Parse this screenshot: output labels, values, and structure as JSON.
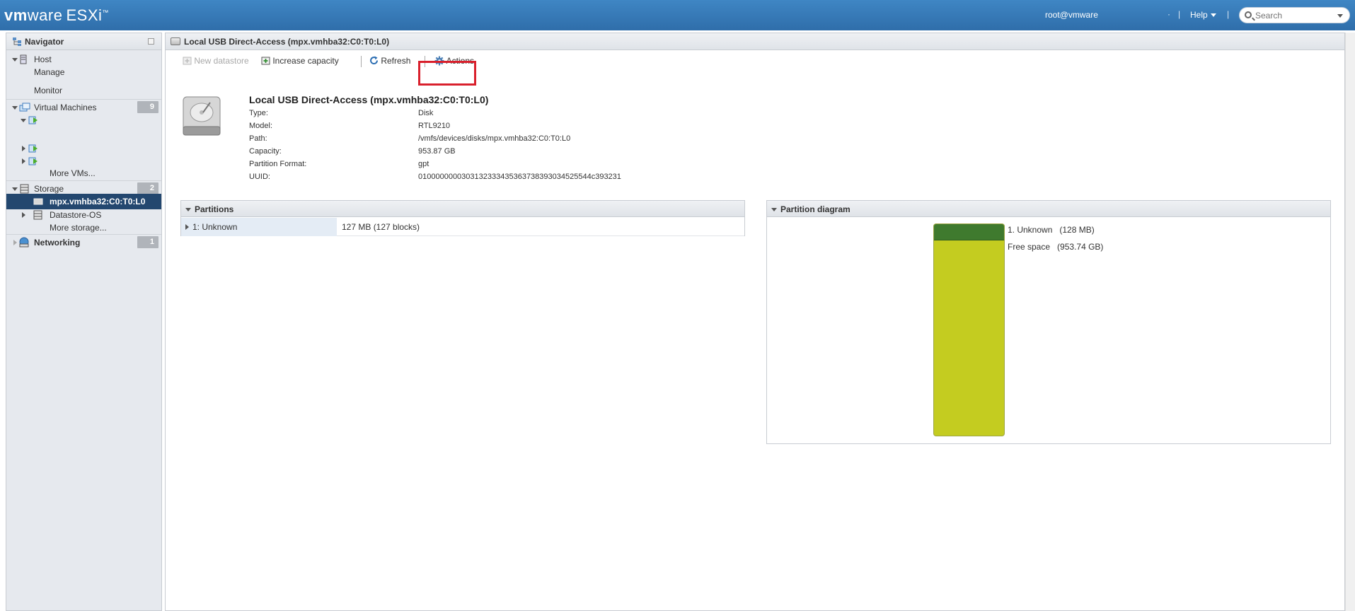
{
  "header": {
    "brand_vm": "vm",
    "brand_ware": "ware",
    "brand_product": "ESXi",
    "user": "root@vmware",
    "sep1": "·",
    "sep2": "|",
    "help_label": "Help",
    "sep3": "|",
    "search_placeholder": "Search"
  },
  "navigator": {
    "title": "Navigator",
    "host": {
      "label": "Host",
      "manage": "Manage",
      "monitor": "Monitor"
    },
    "virtual_machines": {
      "label": "Virtual Machines",
      "count": "9",
      "more": "More VMs..."
    },
    "storage": {
      "label": "Storage",
      "count": "2",
      "selected": "mpx.vmhba32:C0:T0:L0",
      "datastore": "Datastore-OS",
      "more": "More storage..."
    },
    "networking": {
      "label": "Networking",
      "count": "1"
    }
  },
  "main": {
    "title": "Local USB Direct-Access (mpx.vmhba32:C0:T0:L0)",
    "toolbar": {
      "new_datastore": "New datastore",
      "increase_capacity": "Increase capacity",
      "refresh": "Refresh",
      "actions": "Actions"
    },
    "info": {
      "title": "Local USB Direct-Access (mpx.vmhba32:C0:T0:L0)",
      "rows": [
        {
          "key": "Type:",
          "value": "Disk"
        },
        {
          "key": "Model:",
          "value": "RTL9210"
        },
        {
          "key": "Path:",
          "value": "/vmfs/devices/disks/mpx.vmhba32:C0:T0:L0"
        },
        {
          "key": "Capacity:",
          "value": "953.87 GB"
        },
        {
          "key": "Partition Format:",
          "value": "gpt"
        },
        {
          "key": "UUID:",
          "value": "0100000000303132333435363738393034525544c393231"
        }
      ]
    },
    "partitions": {
      "title": "Partitions",
      "rows": [
        {
          "name": "1: Unknown",
          "size": "127 MB (127 blocks)"
        }
      ]
    },
    "diagram": {
      "title": "Partition diagram",
      "legend": [
        {
          "label": "1. Unknown",
          "size": "(128 MB)"
        },
        {
          "label": "Free space",
          "size": "(953.74 GB)"
        }
      ],
      "colors": {
        "used": "#3f7a2e",
        "free": "#c4cc20"
      }
    }
  }
}
